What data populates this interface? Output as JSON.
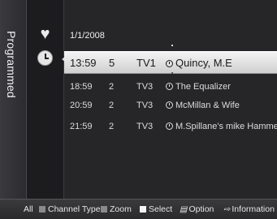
{
  "sidebar": {
    "title": "Programmed"
  },
  "icons": {
    "top": "heart-icon",
    "selected": "clock-icon"
  },
  "list": {
    "date": "1/1/2008",
    "rows": [
      {
        "time": "13:59",
        "ch_num": "5",
        "ch_name": "TV1",
        "title": "Quincy, M.E"
      },
      {
        "time": "18:59",
        "ch_num": "2",
        "ch_name": "TV3",
        "title": "The Equalizer"
      },
      {
        "time": "20:59",
        "ch_num": "2",
        "ch_name": "TV3",
        "title": "McMillan & Wife"
      },
      {
        "time": "21:59",
        "ch_num": "2",
        "ch_name": "TV3",
        "title": "M.Spillane's mike Hammer"
      }
    ]
  },
  "footer": {
    "all": "All",
    "channel_type": "Channel Type",
    "zoom": "Zoom",
    "select": "Select",
    "option": "Option",
    "information": "Information"
  }
}
